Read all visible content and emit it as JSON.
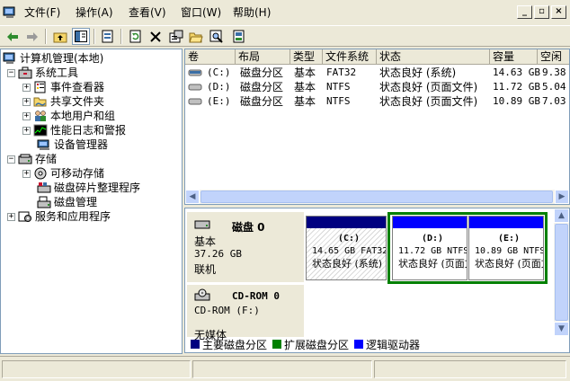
{
  "menu": {
    "file": "文件(F)",
    "action": "操作(A)",
    "view": "查看(V)",
    "window": "窗口(W)",
    "help": "帮助(H)"
  },
  "window_buttons": {
    "minimize": "_",
    "restore": "▫",
    "close": "×"
  },
  "toolbar": {
    "icons": [
      "back-icon",
      "forward-icon",
      "up-icon",
      "show-tree-icon",
      "properties-icon",
      "refresh-icon",
      "delete-icon",
      "properties2-icon",
      "open-icon",
      "search-icon",
      "export-icon"
    ]
  },
  "tree": {
    "root": "计算机管理(本地)",
    "system_tools": "系统工具",
    "event_viewer": "事件查看器",
    "shared_folders": "共享文件夹",
    "local_users": "本地用户和组",
    "perf_logs": "性能日志和警报",
    "device_manager": "设备管理器",
    "storage": "存储",
    "removable_storage": "可移动存储",
    "defrag": "磁盘碎片整理程序",
    "disk_mgmt": "磁盘管理",
    "services_apps": "服务和应用程序"
  },
  "list": {
    "columns": [
      "卷",
      "布局",
      "类型",
      "文件系统",
      "状态",
      "容量",
      "空闲"
    ],
    "rows": [
      {
        "volume": "(C:)",
        "layout": "磁盘分区",
        "type": "基本",
        "fs": "FAT32",
        "status": "状态良好 (系统)",
        "capacity": "14.63 GB",
        "free": "9.38"
      },
      {
        "volume": "(D:)",
        "layout": "磁盘分区",
        "type": "基本",
        "fs": "NTFS",
        "status": "状态良好 (页面文件)",
        "capacity": "11.72 GB",
        "free": "5.04"
      },
      {
        "volume": "(E:)",
        "layout": "磁盘分区",
        "type": "基本",
        "fs": "NTFS",
        "status": "状态良好 (页面文件)",
        "capacity": "10.89 GB",
        "free": "7.03"
      }
    ]
  },
  "disk0": {
    "name": "磁盘 0",
    "type": "基本",
    "size": "37.26 GB",
    "state": "联机",
    "partitions": [
      {
        "title": "(C:)",
        "line1": "14.65 GB FAT32",
        "line2": "状态良好 (系统)",
        "bar_color": "#000080"
      },
      {
        "title": "(D:)",
        "line1": "11.72 GB NTFS",
        "line2": "状态良好 (页面文件)",
        "bar_color": "#0000ff"
      },
      {
        "title": "(E:)",
        "line1": "10.89 GB NTFS",
        "line2": "状态良好 (页面文件)",
        "bar_color": "#0000ff"
      }
    ]
  },
  "cdrom0": {
    "name": "CD-ROM 0",
    "type": "CD-ROM (F:)",
    "media": "无媒体"
  },
  "legend": [
    {
      "label": "主要磁盘分区",
      "color": "#000080"
    },
    {
      "label": "扩展磁盘分区",
      "color": "#008000"
    },
    {
      "label": "逻辑驱动器",
      "color": "#0000ff"
    }
  ]
}
